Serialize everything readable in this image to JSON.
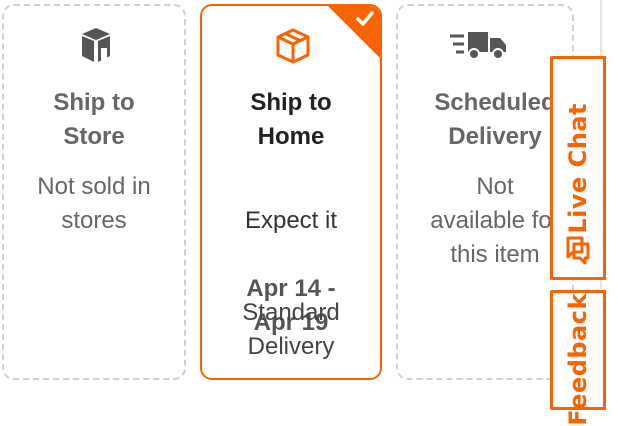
{
  "options": [
    {
      "id": "store",
      "title": "Ship to\nStore",
      "description": "Not sold in\nstores",
      "icon": "store-icon"
    },
    {
      "id": "home",
      "title": "Ship to\nHome",
      "description_prefix": "Expect it",
      "dates": "Apr 14 -\nApr 19",
      "shipping_method": "Standard\nDelivery",
      "icon": "package-icon",
      "selected": true
    },
    {
      "id": "scheduled",
      "title": "Scheduled\nDelivery",
      "description": "Not\navailable for\nthis item",
      "icon": "truck-icon"
    }
  ],
  "side_tabs": {
    "live_chat": "Live Chat",
    "feedback": "Feedback"
  },
  "colors": {
    "accent": "#f96302",
    "disabled_border": "#cfcfcf"
  }
}
